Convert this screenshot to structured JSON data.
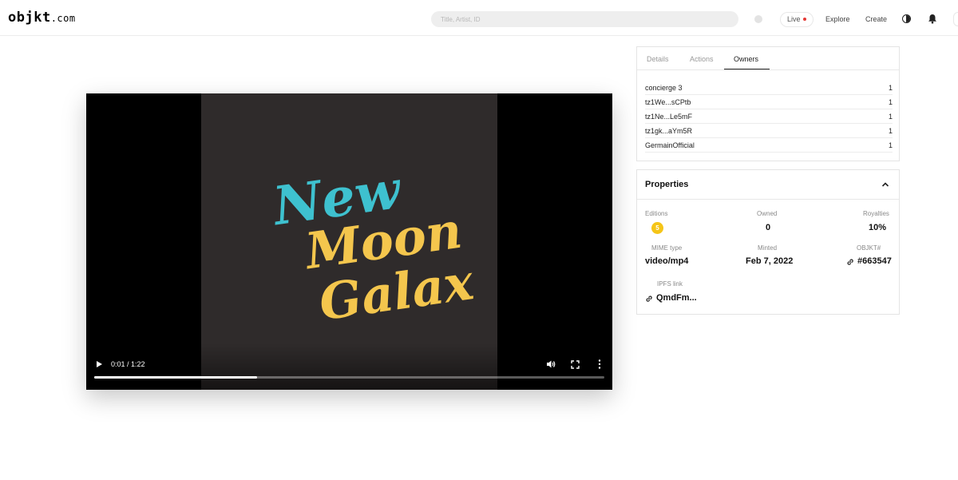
{
  "header": {
    "logo_main": "objkt",
    "logo_domain": ".com",
    "search_placeholder": "Title, Artist, ID",
    "live_label": "Live",
    "explore_label": "Explore",
    "create_label": "Create",
    "icons": [
      "wallet-dot-icon",
      "live-record-icon",
      "theme-toggle-icon",
      "bell-icon"
    ]
  },
  "video": {
    "time_display": "0:01 / 1:22",
    "progress_fraction": 0.32,
    "artwork_text": [
      "New",
      "Moon",
      "Galax"
    ],
    "colors": {
      "background": "#2f2b2b",
      "new": "#3ec1cf",
      "moon_galax": "#f4c64d"
    },
    "icons": [
      "play-icon",
      "volume-icon",
      "fullscreen-icon",
      "more-options-icon"
    ]
  },
  "owners_panel": {
    "tabs": [
      {
        "label": "Details",
        "active": false
      },
      {
        "label": "Actions",
        "active": false
      },
      {
        "label": "Owners",
        "active": true
      }
    ],
    "owners": [
      {
        "name": "concierge 3",
        "qty": "1"
      },
      {
        "name": "tz1We...sCPtb",
        "qty": "1"
      },
      {
        "name": "tz1Ne...Le5mF",
        "qty": "1"
      },
      {
        "name": "tz1gk...aYm5R",
        "qty": "1"
      },
      {
        "name": "GermainOfficial",
        "qty": "1"
      }
    ]
  },
  "properties": {
    "title": "Properties",
    "editions_label": "Editions",
    "editions_value": "5",
    "owned_label": "Owned",
    "owned_value": "0",
    "royalties_label": "Royalties",
    "royalties_value": "10%",
    "mime_label": "MIME type",
    "mime_value": "video/mp4",
    "minted_label": "Minted",
    "minted_value": "Feb 7, 2022",
    "objkt_label": "OBJKT#",
    "objkt_value": "#663547",
    "ipfs_label": "IPFS link",
    "ipfs_value": "QmdFm...",
    "accent_color": "#f5c518"
  }
}
